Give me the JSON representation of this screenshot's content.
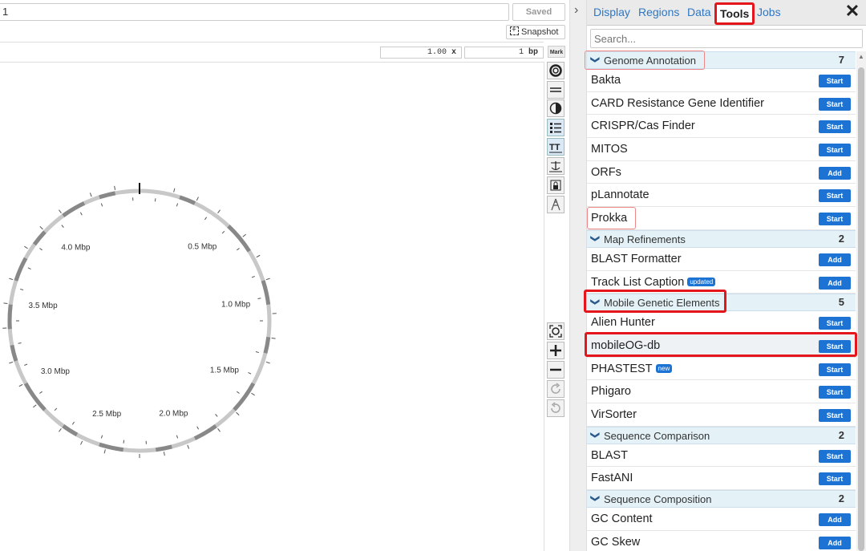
{
  "header": {
    "title_value": "1",
    "saved_label": "Saved",
    "snapshot_label": "Snapshot",
    "zoom_value": "1.00",
    "zoom_unit": "x",
    "bp_value": "1",
    "bp_unit": "bp",
    "mark_label": "Mark"
  },
  "map": {
    "labels": [
      {
        "text": "0.5 Mbp"
      },
      {
        "text": "1.0 Mbp"
      },
      {
        "text": "1.5 Mbp"
      },
      {
        "text": "2.0 Mbp"
      },
      {
        "text": "2.5 Mbp"
      },
      {
        "text": "3.0 Mbp"
      },
      {
        "text": "3.5 Mbp"
      },
      {
        "text": "4.0 Mbp"
      }
    ]
  },
  "toolstrip": {
    "icons": [
      "map-format-icon",
      "legend-lines-icon",
      "contrast-icon",
      "list-icon",
      "text-size-icon",
      "anchor-icon",
      "lock-icon",
      "tower-icon"
    ],
    "zoom_icons": [
      "fit-icon",
      "zoom-in-icon",
      "zoom-out-icon",
      "rotate-cw-icon",
      "rotate-ccw-icon"
    ]
  },
  "tabs": {
    "display": "Display",
    "regions": "Regions",
    "data": "Data",
    "tools": "Tools",
    "jobs": "Jobs",
    "active": "Tools"
  },
  "search": {
    "placeholder": "Search..."
  },
  "groups": [
    {
      "name": "Genome Annotation",
      "count": "7",
      "items": [
        {
          "name": "Bakta",
          "action": "Start"
        },
        {
          "name": "CARD Resistance Gene Identifier",
          "action": "Start"
        },
        {
          "name": "CRISPR/Cas Finder",
          "action": "Start"
        },
        {
          "name": "MITOS",
          "action": "Start"
        },
        {
          "name": "ORFs",
          "action": "Add"
        },
        {
          "name": "pLannotate",
          "action": "Start"
        },
        {
          "name": "Prokka",
          "action": "Start"
        }
      ]
    },
    {
      "name": "Map Refinements",
      "count": "2",
      "items": [
        {
          "name": "BLAST Formatter",
          "action": "Add"
        },
        {
          "name": "Track List Caption",
          "action": "Add",
          "badge": "updated"
        }
      ]
    },
    {
      "name": "Mobile Genetic Elements",
      "count": "5",
      "items": [
        {
          "name": "Alien Hunter",
          "action": "Start"
        },
        {
          "name": "mobileOG-db",
          "action": "Start"
        },
        {
          "name": "PHASTEST",
          "action": "Start",
          "badge": "new"
        },
        {
          "name": "Phigaro",
          "action": "Start"
        },
        {
          "name": "VirSorter",
          "action": "Start"
        }
      ]
    },
    {
      "name": "Sequence Comparison",
      "count": "2",
      "items": [
        {
          "name": "BLAST",
          "action": "Start"
        },
        {
          "name": "FastANI",
          "action": "Start"
        }
      ]
    },
    {
      "name": "Sequence Composition",
      "count": "2",
      "items": [
        {
          "name": "GC Content",
          "action": "Add"
        },
        {
          "name": "GC Skew",
          "action": "Add"
        }
      ]
    }
  ],
  "colors": {
    "accent": "#1c73d4",
    "highlight_red": "#e4161b",
    "group_bg": "#e4f2f7"
  }
}
